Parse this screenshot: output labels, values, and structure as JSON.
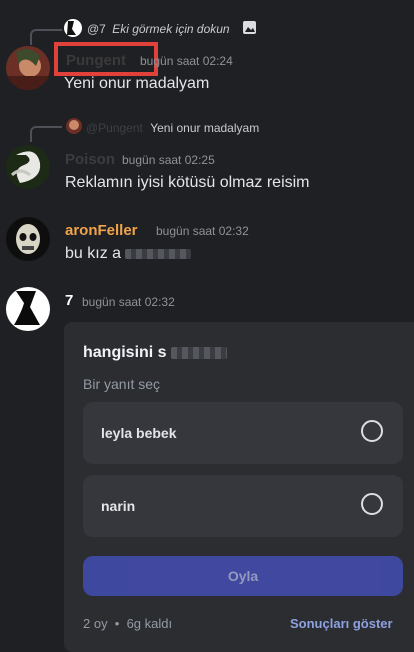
{
  "messages": [
    {
      "reply": {
        "author": "@7",
        "text": "Eki görmek için dokun"
      },
      "username": "Pungent",
      "username_color": "#3a3a3a",
      "timestamp": "bugün saat 02:24",
      "text": "Yeni onur madalyam"
    },
    {
      "reply": {
        "author": "@Pungent",
        "text": "Yeni onur madalyam"
      },
      "username": "Poison",
      "username_color": "#3a3c40",
      "timestamp": "bugün saat 02:25",
      "text": "Reklamın iyisi kötüsü olmaz reisim"
    },
    {
      "username": "aronFeller",
      "username_color": "#f0a44a",
      "timestamp": "bugün saat 02:32",
      "text": "bu kız a"
    },
    {
      "username": "7",
      "username_color": "#ffffff",
      "timestamp": "bugün saat 02:32"
    }
  ],
  "poll": {
    "question": "hangisini s",
    "hint": "Bir yanıt seç",
    "options": [
      "leyla bebek",
      "narin"
    ],
    "vote_label": "Oyla",
    "footer_meta": "2 oy  •  6g kaldı",
    "show_results": "Sonuçları göster"
  },
  "colors": {
    "background": "#1f2024",
    "accent": "#4752c4",
    "link": "#8ea1e1",
    "highlight_box": "#e0413a"
  }
}
